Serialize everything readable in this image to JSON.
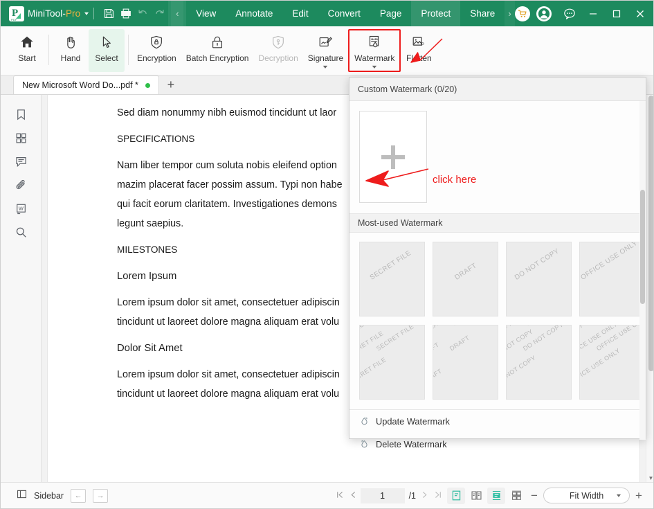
{
  "titlebar": {
    "brand_main": "MiniTool",
    "brand_sep": "-",
    "brand_pro": "Pro",
    "dropdown_caret": "▼",
    "quick_icons": [
      "save-icon",
      "print-icon",
      "undo-icon",
      "redo-icon"
    ],
    "prev_chevron": "‹",
    "next_chevron": "›",
    "menu_tabs": [
      {
        "label": "View",
        "active": false
      },
      {
        "label": "Annotate",
        "active": false
      },
      {
        "label": "Edit",
        "active": false
      },
      {
        "label": "Convert",
        "active": false
      },
      {
        "label": "Page",
        "active": false
      },
      {
        "label": "Protect",
        "active": true
      },
      {
        "label": "Share",
        "active": false
      }
    ],
    "cart_icon": "shopping-cart-icon",
    "account_icon": "user-account-icon",
    "feedback_icon": "feedback-chat-icon",
    "minimize": "─",
    "maximize": "□",
    "close": "✕"
  },
  "ribbon": {
    "items": [
      {
        "label": "Start",
        "icon": "home-icon",
        "state": "normal",
        "caret": false
      },
      {
        "label": "Hand",
        "icon": "hand-icon",
        "state": "normal",
        "caret": false
      },
      {
        "label": "Select",
        "icon": "cursor-select-icon",
        "state": "selected",
        "caret": false
      },
      {
        "label": "Encryption",
        "icon": "shield-lock-icon",
        "state": "normal",
        "caret": false
      },
      {
        "label": "Batch Encryption",
        "icon": "padlock-icon",
        "state": "normal",
        "caret": false
      },
      {
        "label": "Decryption",
        "icon": "shield-key-icon",
        "state": "disabled",
        "caret": false
      },
      {
        "label": "Signature",
        "icon": "signature-pen-icon",
        "state": "normal",
        "caret": true
      },
      {
        "label": "Watermark",
        "icon": "watermark-icon",
        "state": "highlighted",
        "caret": true
      },
      {
        "label": "Flatten",
        "icon": "flatten-image-icon",
        "state": "normal",
        "caret": false
      }
    ],
    "highlight_color": "#ee1c1c"
  },
  "tabstrip": {
    "document_tab": "New Microsoft Word Do...pdf *",
    "modified_dot": true,
    "new_tab": "+"
  },
  "rail": {
    "items": [
      {
        "name": "bookmark-icon",
        "label": "Bookmarks"
      },
      {
        "name": "thumbnails-icon",
        "label": "Thumbnails"
      },
      {
        "name": "comments-icon",
        "label": "Comments"
      },
      {
        "name": "attachment-icon",
        "label": "Attachments"
      },
      {
        "name": "word-export-icon",
        "label": "Word"
      },
      {
        "name": "search-icon",
        "label": "Search"
      }
    ]
  },
  "document": {
    "paragraphs": [
      {
        "text": "Sed diam nonummy nibh euismod tincidunt ut laor",
        "style": "body"
      },
      {
        "text": "SPECIFICATIONS",
        "style": "heading"
      },
      {
        "text": "Nam liber tempor cum soluta nobis eleifend option",
        "style": "body"
      },
      {
        "text": "mazim placerat facer possim assum. Typi non habe",
        "style": "body"
      },
      {
        "text": "qui facit eorum claritatem. Investigationes demons",
        "style": "body"
      },
      {
        "text": "legunt saepius.",
        "style": "body"
      },
      {
        "text": "MILESTONES",
        "style": "heading"
      },
      {
        "text": "Lorem Ipsum",
        "style": "title"
      },
      {
        "text": "Lorem ipsum dolor sit amet, consectetuer adipiscin",
        "style": "body"
      },
      {
        "text": "tincidunt ut laoreet dolore magna aliquam erat volu",
        "style": "body"
      },
      {
        "text": "Dolor Sit Amet",
        "style": "title"
      },
      {
        "text": "Lorem ipsum dolor sit amet, consectetuer adipiscin",
        "style": "body"
      },
      {
        "text": "tincidunt ut laoreet dolore magna aliquam erat volu",
        "style": "body"
      }
    ]
  },
  "watermark_panel": {
    "custom_header": "Custom Watermark (0/20)",
    "add_card_icon": "plus-icon",
    "annotation_text": "click here",
    "annotation_color": "#ee1c1c",
    "most_used_header": "Most-used Watermark",
    "presets_row1": [
      {
        "label": "SECRET FILE",
        "mode": "single"
      },
      {
        "label": "DRAFT",
        "mode": "single"
      },
      {
        "label": "DO NOT COPY",
        "mode": "single"
      },
      {
        "label": "OFFICE USE ONLY",
        "mode": "single"
      }
    ],
    "presets_row2": [
      {
        "label": "SECRET FILE",
        "mode": "tiled"
      },
      {
        "label": "DRAFT",
        "mode": "tiled"
      },
      {
        "label": "DO NOT COPY",
        "mode": "tiled"
      },
      {
        "label": "OFFICE USE ONLY",
        "mode": "tiled"
      }
    ],
    "actions": [
      {
        "label": "Update Watermark",
        "icon": "update-watermark-icon"
      },
      {
        "label": "Delete Watermark",
        "icon": "delete-watermark-icon"
      }
    ]
  },
  "statusbar": {
    "sidebar_label": "Sidebar",
    "sidebar_icon": "sidebar-panel-icon",
    "back_arrow": "←",
    "forward_arrow": "→",
    "first_page": "⏮",
    "prev_page": "‹",
    "page_number": "1",
    "page_total": "/1",
    "next_page": "›",
    "last_page": "⏭",
    "view_modes": [
      {
        "name": "single-page-view-icon",
        "active": true
      },
      {
        "name": "two-page-view-icon",
        "active": false
      },
      {
        "name": "continuous-scroll-view-icon",
        "active": true
      },
      {
        "name": "two-page-continuous-view-icon",
        "active": false
      }
    ],
    "zoom_out": "−",
    "zoom_value": "Fit Width",
    "zoom_caret": "▾",
    "zoom_in": "+",
    "accent_color": "#2bbca0"
  }
}
